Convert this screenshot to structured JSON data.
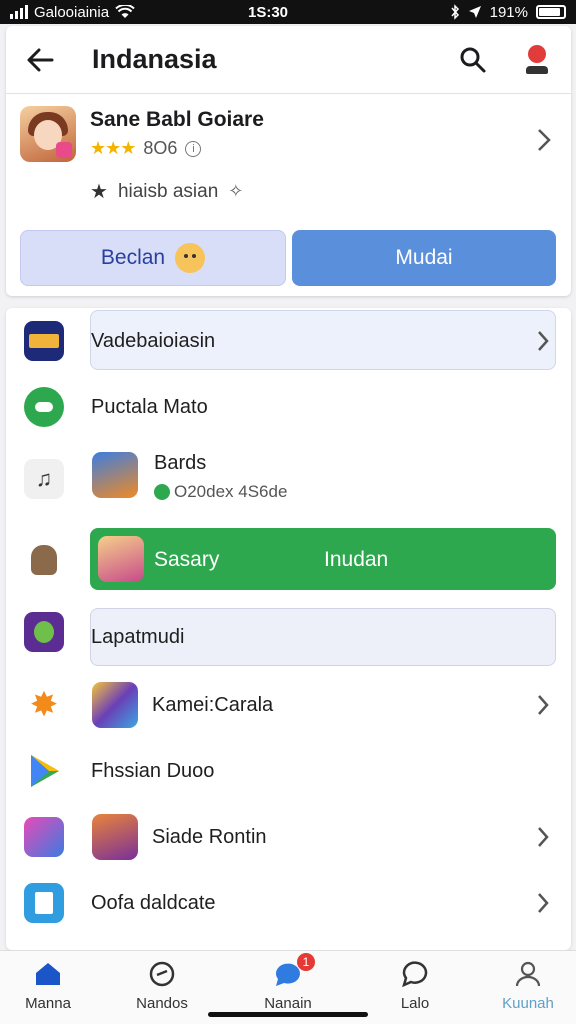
{
  "status_bar": {
    "carrier": "Galooiainia",
    "time": "1S:30",
    "battery": "191%"
  },
  "header": {
    "title": "Indanasia"
  },
  "app": {
    "name": "Sane Babl Goiare",
    "rating_stars": "★★★",
    "rating_count": "8O6",
    "tag": "hiaisb asian"
  },
  "actions": {
    "secondary_label": "Beclan",
    "primary_label": "Mudai"
  },
  "list": {
    "row1_label": "Vadebaioiasin",
    "row2_label": "Puctala Mato",
    "row3_title": "Bards",
    "row3_sub": "O20dex 4S6de",
    "row4_left": "Sasary",
    "row4_right": "Inudan",
    "row5_label": "Lapatmudi",
    "row6_label": "Kamei:Carala",
    "row7_label": "Fhssian Duoo",
    "row8_label": "Siade Rontin",
    "row9_label": "Oofa daldcate"
  },
  "bottom_nav": {
    "items": [
      "Manna",
      "Nandos",
      "Nanain",
      "Lalo",
      "Kuunah"
    ],
    "badge_count": "1",
    "active_color": "#1a56c8"
  }
}
